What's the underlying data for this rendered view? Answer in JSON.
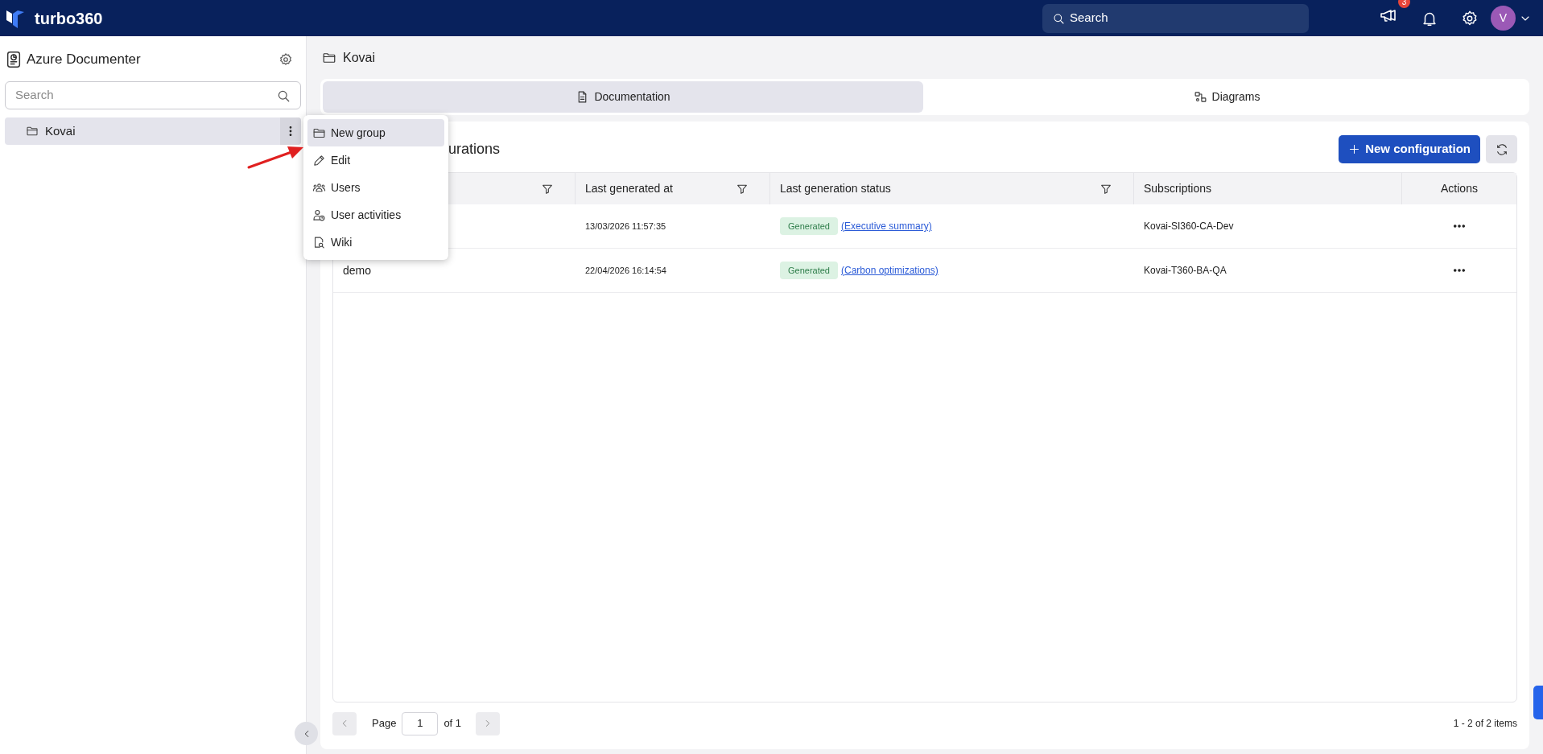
{
  "topbar": {
    "brand": "turbo360",
    "search_placeholder": "Search",
    "announcement_count": "3",
    "avatar_initial": "V"
  },
  "sidebar": {
    "title": "Azure Documenter",
    "search_placeholder": "Search",
    "items": [
      {
        "label": "Kovai",
        "selected": true
      }
    ]
  },
  "context_menu": {
    "items": [
      {
        "label": "New group",
        "kind": "folder",
        "selected": true
      },
      {
        "label": "Edit",
        "kind": "pencil",
        "selected": false
      },
      {
        "label": "Users",
        "kind": "users",
        "selected": false
      },
      {
        "label": "User activities",
        "kind": "user-clock",
        "selected": false
      },
      {
        "label": "Wiki",
        "kind": "doc-search",
        "selected": false
      }
    ]
  },
  "breadcrumb": "Kovai",
  "tabs": [
    {
      "label": "Documentation",
      "kind": "document",
      "selected": true
    },
    {
      "label": "Diagrams",
      "kind": "diagram",
      "selected": false
    }
  ],
  "panel": {
    "title": "urations",
    "new_button": "New configuration"
  },
  "table": {
    "columns": [
      {
        "filter": true
      },
      {
        "label": "Last generated at",
        "filter": true
      },
      {
        "label": "Last generation status",
        "filter": true
      },
      {
        "label": "Subscriptions",
        "filter": false
      },
      {
        "label": "Actions",
        "filter": false
      }
    ],
    "rows": [
      {
        "generated_at": "13/03/2026 11:57:35",
        "status": "Generated",
        "report": "(Executive summary)",
        "subscription": "Kovai-SI360-CA-Dev"
      },
      {
        "name": "demo",
        "generated_at": "22/04/2026 16:14:54",
        "status": "Generated",
        "report": "(Carbon optimizations)",
        "subscription": "Kovai-T360-BA-QA"
      }
    ]
  },
  "pagination": {
    "page_label": "Page",
    "page": "1",
    "of_label": "of 1",
    "summary": "1 - 2 of 2 items"
  }
}
